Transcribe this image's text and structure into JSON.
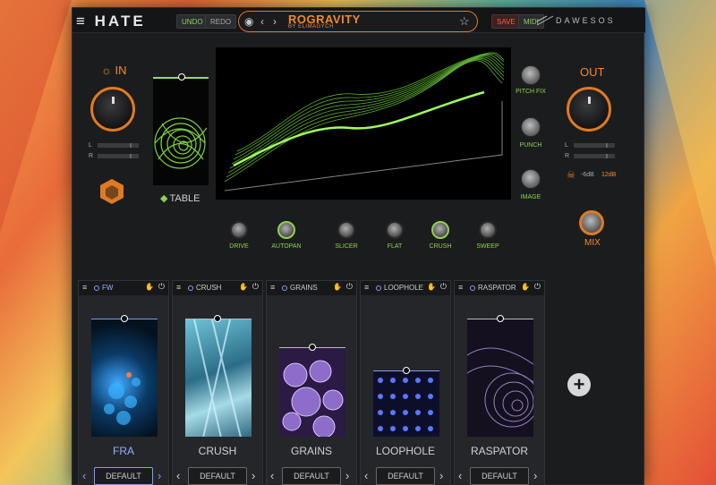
{
  "header": {
    "logo": "HATE",
    "undo": "UNDO",
    "redo": "REDO",
    "preset_name": "ROGRAVITY",
    "preset_author": "BY ELIMAGYCH",
    "save": "SAVE",
    "midi": "MIDI",
    "brand": "DAWESOS"
  },
  "input": {
    "label": "IN",
    "l": "L",
    "r": "R"
  },
  "output": {
    "label": "OUT",
    "l": "L",
    "r": "R",
    "db1": "-6dB",
    "db2": "12dB",
    "mix_label": "MIX"
  },
  "table": {
    "label": "TABLE"
  },
  "side_knobs": [
    {
      "label": "PITCH FIX"
    },
    {
      "label": "PUNCH"
    },
    {
      "label": "IMAGE"
    }
  ],
  "knobs": [
    {
      "label": "DRIVE"
    },
    {
      "label": "AUTOPAN"
    },
    {
      "label": "SLICER"
    },
    {
      "label": "FLAT"
    },
    {
      "label": "CRUSH"
    },
    {
      "label": "SWEEP"
    }
  ],
  "slots": [
    {
      "title": "FW",
      "name": "FRA",
      "preset": "DEFAULT",
      "accent": true
    },
    {
      "title": "CRUSH",
      "name": "CRUSH",
      "preset": "DEFAULT",
      "accent": false
    },
    {
      "title": "GRAINS",
      "name": "GRAINS",
      "preset": "DEFAULT",
      "accent": false
    },
    {
      "title": "LOOPHOLE",
      "name": "LOOPHOLE",
      "preset": "DEFAULT",
      "accent": false
    },
    {
      "title": "RASPATOR",
      "name": "RASPATOR",
      "preset": "DEFAULT",
      "accent": false
    }
  ],
  "colors": {
    "accent_orange": "#e07a22",
    "accent_green": "#8fd14f",
    "accent_blue": "#7c9cff"
  }
}
